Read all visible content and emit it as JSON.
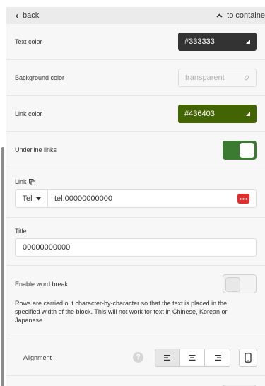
{
  "nav": {
    "back_label": "back",
    "container_label": "to containe"
  },
  "text_color": {
    "label": "Text color",
    "value": "#333333",
    "swatch": "#333333"
  },
  "background_color": {
    "label": "Background color",
    "value": "transparent"
  },
  "link_color": {
    "label": "Link color",
    "value": "#436403",
    "swatch": "#436403"
  },
  "underline_links": {
    "label": "Underline links",
    "enabled": true
  },
  "link": {
    "label": "Link",
    "type_value": "Tel",
    "value": "tel:00000000000"
  },
  "title": {
    "label": "Title",
    "value": "00000000000"
  },
  "word_break": {
    "label": "Enable word break",
    "enabled": false,
    "help": "Rows are carried out character-by-character so that the text is placed in the specified width of the block. This will not work for text in Chinese, Korean or Japanese."
  },
  "alignment": {
    "label": "Alignment",
    "help_glyph": "?",
    "options": [
      "align-left",
      "align-center",
      "align-right"
    ],
    "selected": "align-left"
  },
  "colors": {
    "accent_green": "#436403",
    "toggle_on": "#3b7a31",
    "dots_red": "#e02d2d"
  }
}
